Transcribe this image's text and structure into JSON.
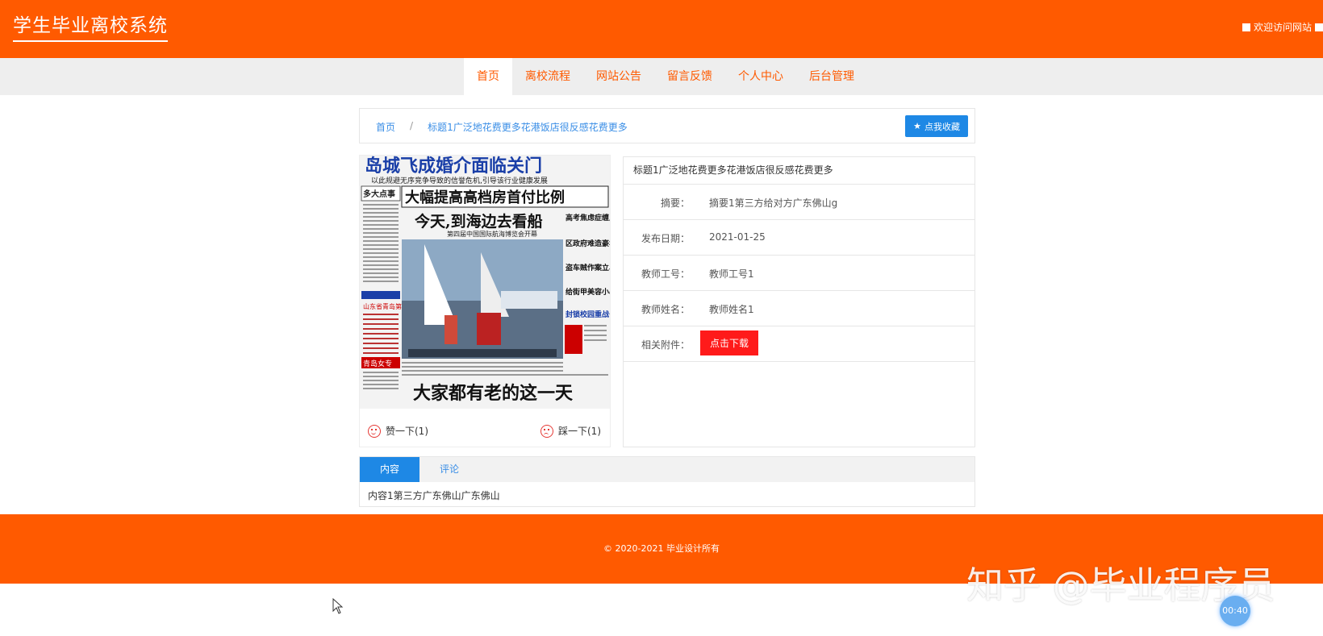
{
  "header": {
    "site_title": "学生毕业离校系统",
    "welcome": "欢迎访问网站"
  },
  "nav": {
    "items": [
      "首页",
      "离校流程",
      "网站公告",
      "留言反馈",
      "个人中心",
      "后台管理"
    ],
    "active_index": 0
  },
  "breadcrumb": {
    "home": "首页",
    "separator": "/",
    "current": "标题1广泛地花费更多花港饭店很反感花费更多"
  },
  "favorite_button": "点我收藏",
  "newspaper": {
    "headline_top": "岛城飞成婚介面临关门",
    "subline_top": "以此规避无序竞争导致的信誉危机,引导该行业健康发展",
    "section": "多大点事",
    "headline_main": "大幅提高高档房首付比例",
    "photo_title": "今天,到海边去看船",
    "photo_subtitle": "第四届中国国际航海博览会开幕",
    "right_col": [
      "高考焦虑症缠上家长",
      "区政府难造豪华大楼",
      "盗车贼作案立马落网",
      "给街甲美容小心长病",
      "封锁校园重战号角"
    ],
    "left_col": [
      "山东省青岛第十一中学",
      "青岛女专"
    ],
    "headline_bottom": "大家都有老的这一天"
  },
  "votes": {
    "like": "赞一下(1)",
    "dislike": "踩一下(1)"
  },
  "detail": {
    "title": "标题1广泛地花费更多花港饭店很反感花费更多",
    "rows": [
      {
        "label": "摘要：",
        "value": "摘要1第三方给对方广东佛山g"
      },
      {
        "label": "发布日期：",
        "value": "2021-01-25"
      },
      {
        "label": "教师工号：",
        "value": "教师工号1"
      },
      {
        "label": "教师姓名：",
        "value": "教师姓名1"
      }
    ],
    "attachment_label": "相关附件：",
    "download_button": "点击下载"
  },
  "tabs": {
    "items": [
      "内容",
      "评论"
    ],
    "active_index": 0,
    "content": "内容1第三方广东佛山广东佛山"
  },
  "footer": {
    "copyright": "© 2020-2021 毕业设计所有"
  },
  "overlay": {
    "watermark": "知乎 @毕业程序员",
    "timer": "00:40"
  },
  "colors": {
    "brand": "#ff5a00",
    "primary": "#1e88e5",
    "danger": "#ff1a1a"
  }
}
